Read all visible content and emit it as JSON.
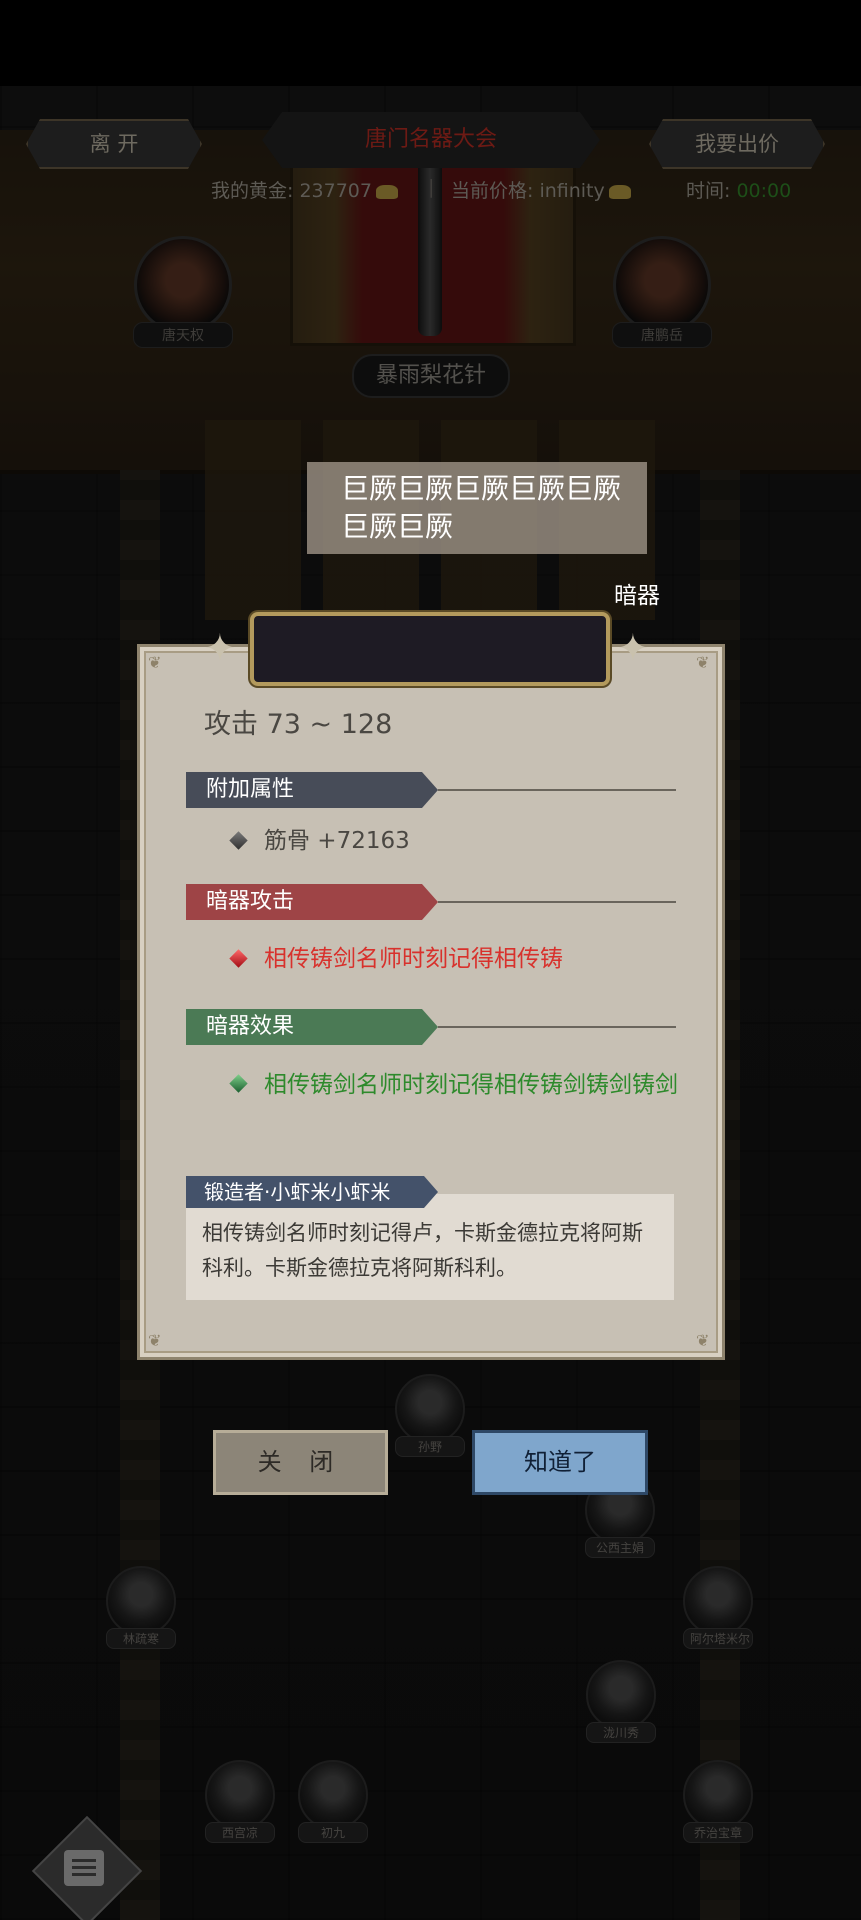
{
  "header": {
    "leave_label": "离 开",
    "title": "唐门名器大会",
    "bid_label": "我要出价",
    "gold_text": "我的黄金: 237707",
    "price_text": "当前价格: infinity",
    "time_label": "时间:",
    "time_value": "00:00"
  },
  "scene": {
    "left_host": "唐天权",
    "right_host": "唐鹏岳",
    "weapon_name": "暴雨梨花针",
    "npcs": [
      "孙野",
      "公西主娟",
      "林疏寒",
      "阿尔塔米尔",
      "泷川秀",
      "西宫凉",
      "初九",
      "乔治宝章"
    ]
  },
  "item": {
    "name": "巨厥巨厥巨厥巨厥巨厥巨厥巨厥",
    "type": "暗器",
    "attack": "攻击  73 ~ 128",
    "sections": {
      "extra_title": "附加属性",
      "extra_text": "筋骨 +72163",
      "attack_title": "暗器攻击",
      "attack_text": "相传铸剑名师时刻记得相传铸",
      "effect_title": "暗器效果",
      "effect_text": "相传铸剑名师时刻记得相传铸剑铸剑铸剑"
    },
    "forger_label": "锻造者·小虾米小虾米",
    "forger_desc": "相传铸剑名师时刻记得卢，卡斯金德拉克将阿斯科利。卡斯金德拉克将阿斯科利。"
  },
  "buttons": {
    "close": "关 闭",
    "ok": "知道了"
  },
  "colors": {
    "attack_text": "#d8312c",
    "effect_text": "#2e8a2c",
    "ok_button": "#7fa6cc"
  }
}
